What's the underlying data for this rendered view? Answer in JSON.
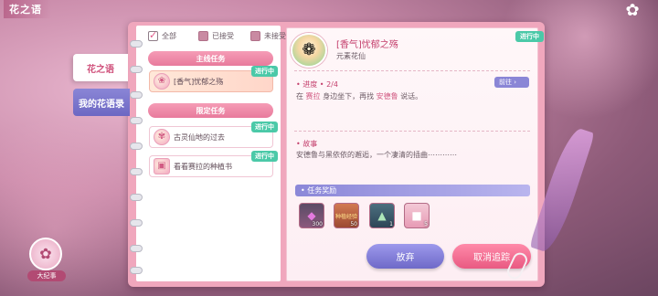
{
  "header": {
    "title": "花之语",
    "logo_icon": "flower-logo-icon"
  },
  "side_tabs": [
    {
      "label": "花之语",
      "active": true
    },
    {
      "label": "我的花语录",
      "active": false
    }
  ],
  "filters": [
    {
      "label": "全部",
      "checked": true
    },
    {
      "label": "已接受",
      "checked": false
    },
    {
      "label": "未接受",
      "checked": false
    }
  ],
  "sections": {
    "main": "主线任务",
    "limited": "限定任务"
  },
  "quests": [
    {
      "title": "[香气]忧郁之殇",
      "status": "进行中",
      "selected": true
    },
    {
      "title": "古灵仙地的过去",
      "status": "进行中",
      "selected": false
    },
    {
      "title": "看看赛拉的种植书",
      "status": "进行中",
      "selected": false
    }
  ],
  "detail": {
    "title": "[香气]忧郁之殇",
    "subtitle": "元素花仙",
    "status": "进行中",
    "progress_label": "进度",
    "progress_value": "2/4",
    "progress_text_pre": "在",
    "progress_text_name1": "赛拉",
    "progress_text_mid": "身边坐下，再找",
    "progress_text_name2": "安德鲁",
    "progress_text_post": "说话。",
    "goto_label": "前往",
    "story_label": "故事",
    "story_text": "安德鲁与黑依依的邂逅，一个凄清的插曲⋯⋯⋯⋯",
    "reward_label": "任务奖励",
    "rewards": [
      {
        "icon": "gem-icon",
        "count": "300"
      },
      {
        "icon": "seed-book-icon",
        "label": "种植经验",
        "count": "50"
      },
      {
        "icon": "crystal-icon",
        "count": "1"
      },
      {
        "icon": "pink-box-icon",
        "count": "5"
      }
    ]
  },
  "buttons": {
    "give_up": "放弃",
    "cancel_track": "取消追踪"
  },
  "chronicle": {
    "label": "大纪事"
  },
  "colors": {
    "accent_pink": "#e87a9c",
    "accent_purple": "#8a86d6",
    "status_green": "#4bc9a8"
  }
}
